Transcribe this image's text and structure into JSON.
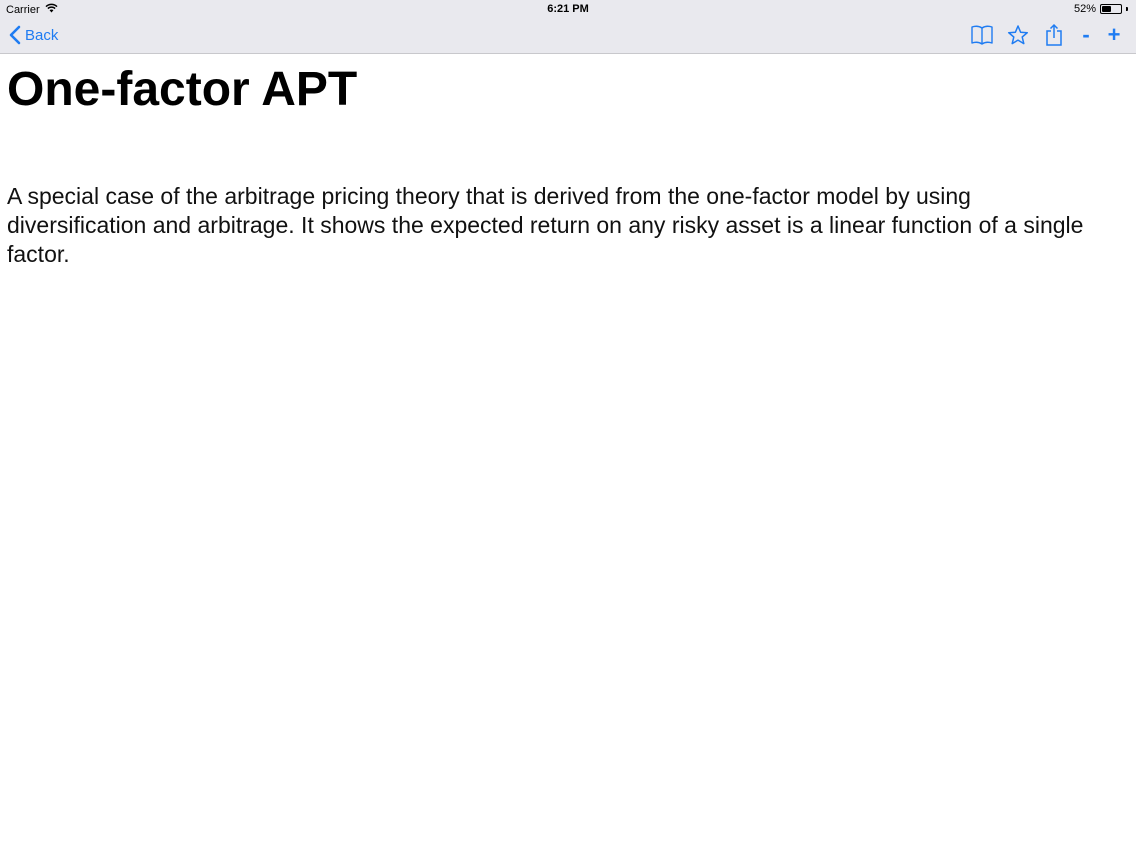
{
  "status_bar": {
    "carrier": "Carrier",
    "time": "6:21 PM",
    "battery_percent": "52%",
    "battery_level": 0.52
  },
  "nav_bar": {
    "back_label": "Back",
    "accent_color": "#1f7cf2",
    "icons": [
      "book-icon",
      "star-icon",
      "share-icon"
    ],
    "zoom_out_label": "-",
    "zoom_in_label": "+"
  },
  "entry": {
    "title": "One-factor APT",
    "definition": "A special case of the arbitrage pricing theory that is derived from the one-factor model by using diversification and arbitrage. It shows the expected return on any risky asset is a linear function of a single factor."
  }
}
